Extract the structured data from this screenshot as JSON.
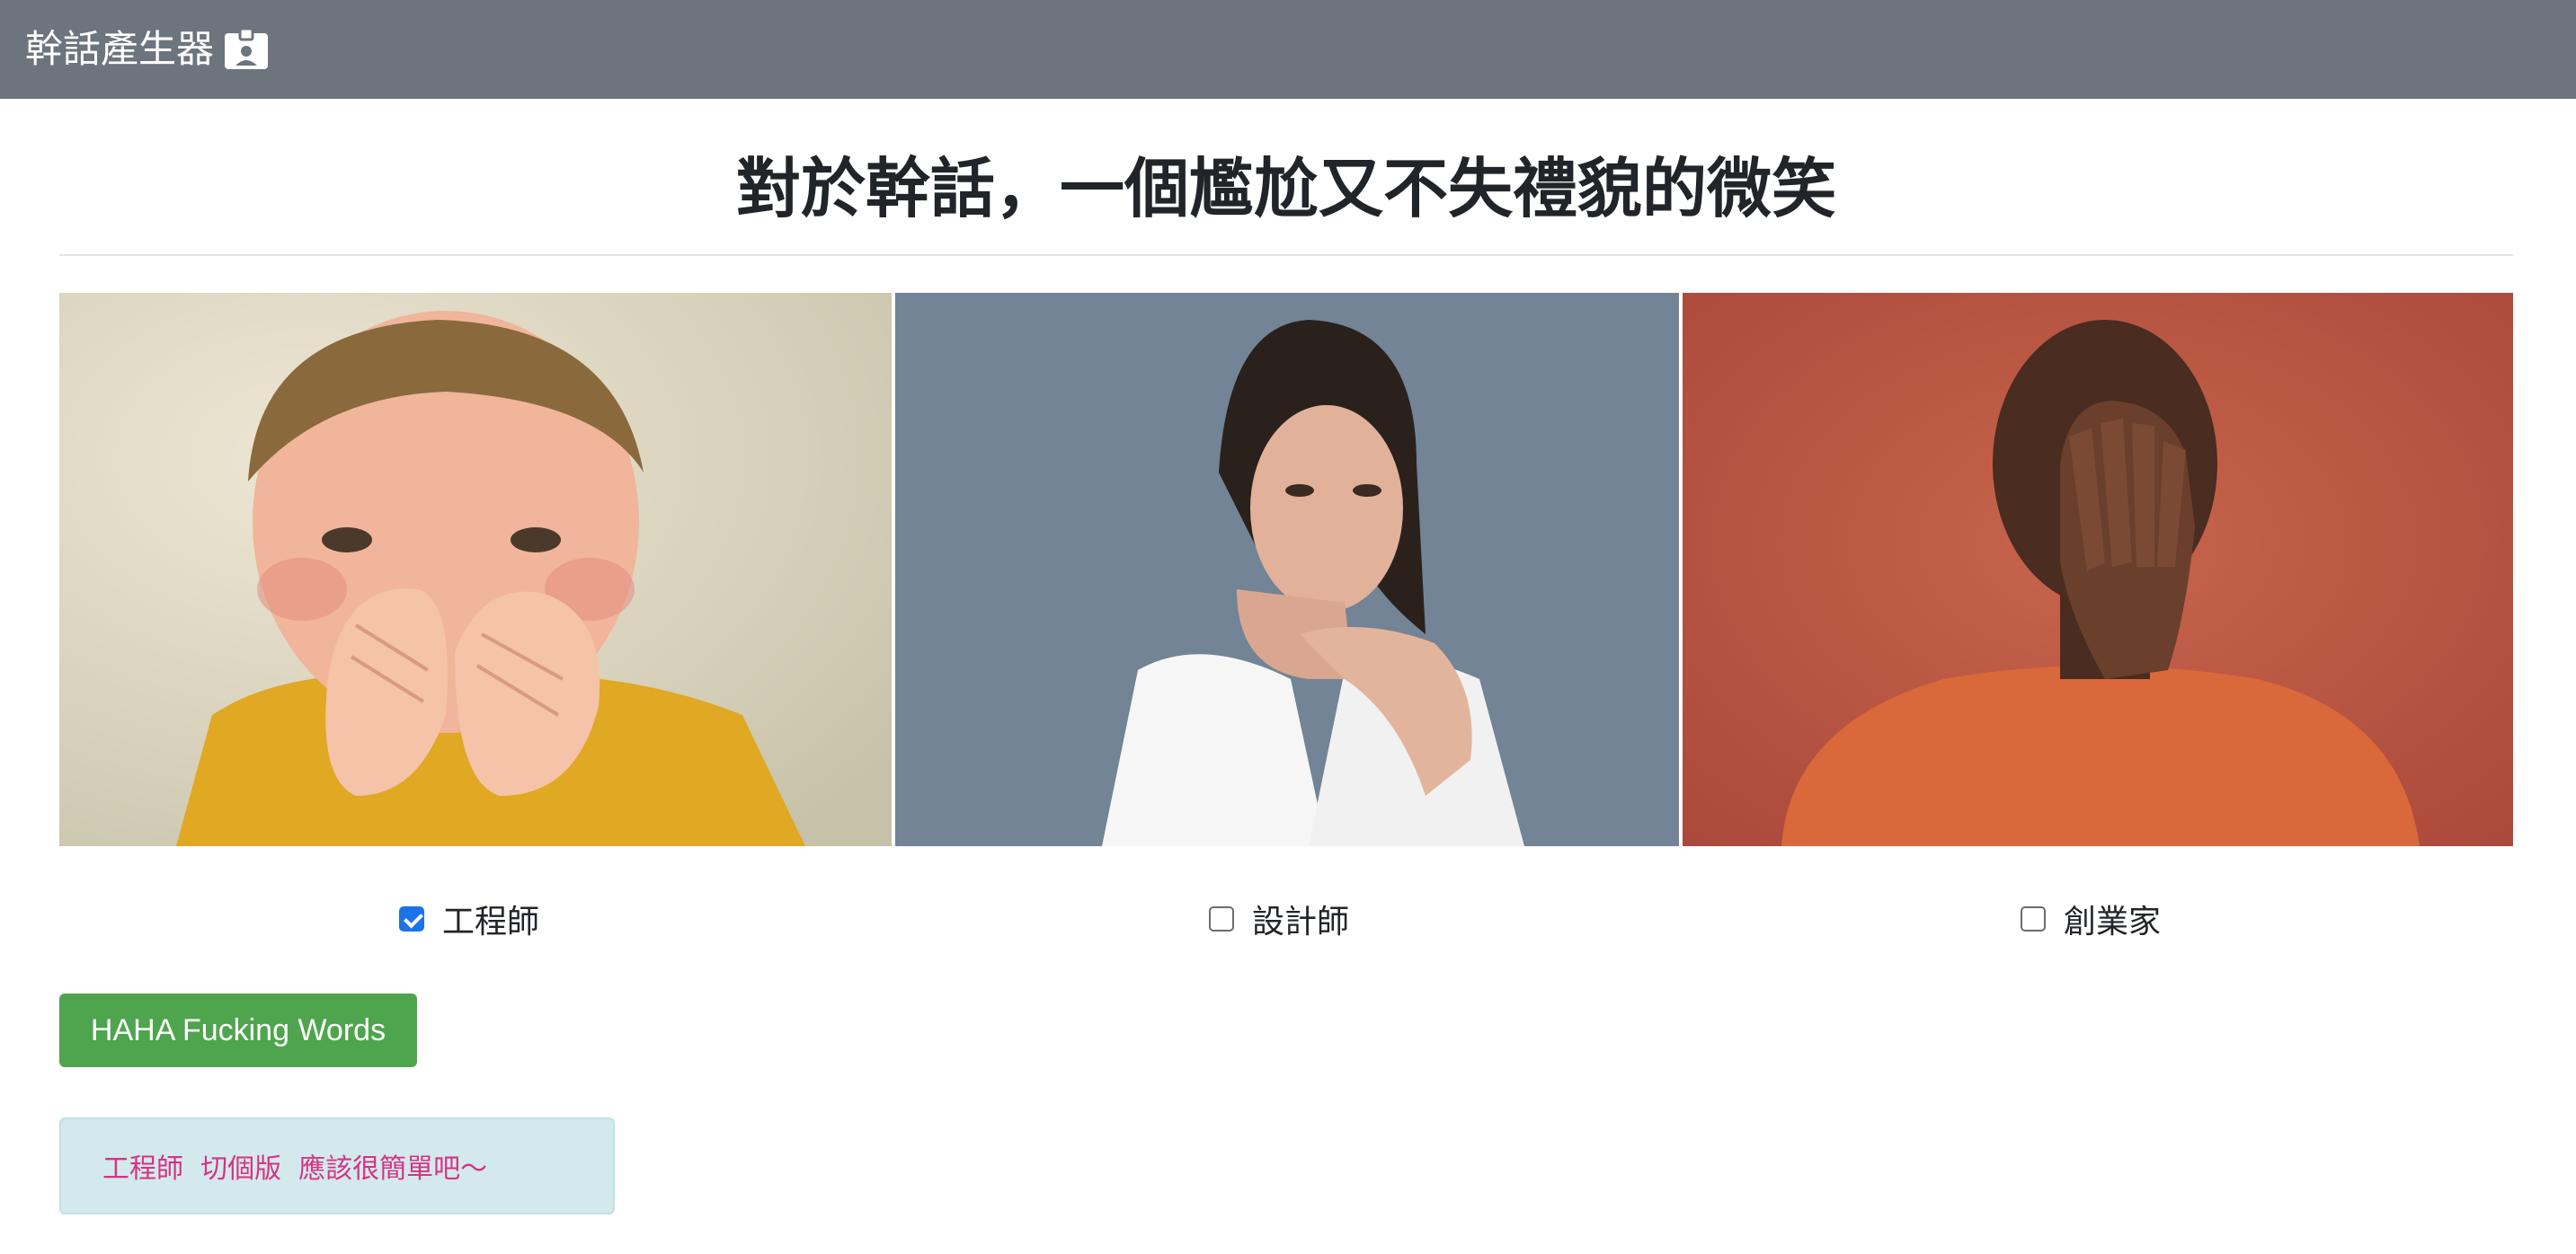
{
  "navbar": {
    "brand": "幹話產生器",
    "brand_icon": "id-badge-icon",
    "background": "#6c757d"
  },
  "page": {
    "title": "對於幹話，一個尷尬又不失禮貌的微笑"
  },
  "photos": [
    {
      "description_icon": "child-laughing-photo"
    },
    {
      "description_icon": "woman-laughing-photo"
    },
    {
      "description_icon": "man-facepalm-photo"
    }
  ],
  "roles": [
    {
      "label": "工程師",
      "checked": true
    },
    {
      "label": "設計師",
      "checked": false
    },
    {
      "label": "創業家",
      "checked": false
    }
  ],
  "generate_button": {
    "label": "HAHA Fucking Words",
    "color": "#4fa54d"
  },
  "result": {
    "text": "工程師  切個版  應該很簡單吧～",
    "text_color": "#d63384",
    "background": "#d3e9ed"
  }
}
